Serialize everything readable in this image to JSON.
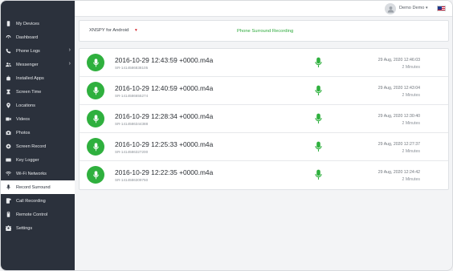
{
  "sidebar": {
    "items": [
      {
        "label": "My Devices",
        "icon": "phone-icon",
        "has_submenu": false
      },
      {
        "label": "Dashboard",
        "icon": "dashboard-icon",
        "has_submenu": false
      },
      {
        "label": "Phone Logs",
        "icon": "phone-logs-icon",
        "has_submenu": true
      },
      {
        "label": "Messenger",
        "icon": "users-icon",
        "has_submenu": true
      },
      {
        "label": "Installed Apps",
        "icon": "apps-icon",
        "has_submenu": false
      },
      {
        "label": "Screen Time",
        "icon": "hourglass-icon",
        "has_submenu": false
      },
      {
        "label": "Locations",
        "icon": "location-pin-icon",
        "has_submenu": false
      },
      {
        "label": "Videos",
        "icon": "video-icon",
        "has_submenu": false
      },
      {
        "label": "Photos",
        "icon": "camera-icon",
        "has_submenu": false
      },
      {
        "label": "Screen Record",
        "icon": "record-icon",
        "has_submenu": false
      },
      {
        "label": "Key Logger",
        "icon": "keyboard-icon",
        "has_submenu": false
      },
      {
        "label": "Wi-Fi Networks",
        "icon": "wifi-icon",
        "has_submenu": false
      },
      {
        "label": "Record Surround",
        "icon": "microphone-icon",
        "has_submenu": false,
        "active": true
      },
      {
        "label": "Call Recording",
        "icon": "call-recording-icon",
        "has_submenu": false
      },
      {
        "label": "Remote Control",
        "icon": "remote-control-icon",
        "has_submenu": false
      },
      {
        "label": "Settings",
        "icon": "gear-icon",
        "has_submenu": false
      }
    ]
  },
  "topbar": {
    "user_name": "Demo Demo",
    "user_caret": "▾",
    "flag_icon": "us-flag-icon"
  },
  "header": {
    "device_name": "XNSPY for Android",
    "device_caret": "▾",
    "title": "Phone Surround Recording"
  },
  "recordings": [
    {
      "file": "2016-10-29 12:43:59 +0000.m4a",
      "id": "SR-1414586838105",
      "date": "29 Aug, 2020 12:46:03",
      "duration": "2 Minutes"
    },
    {
      "file": "2016-10-29 12:40:59 +0000.m4a",
      "id": "SR-1414586655274",
      "date": "29 Aug, 2020 12:43:04",
      "duration": "2 Minutes"
    },
    {
      "file": "2016-10-29 12:28:34 +0000.m4a",
      "id": "SR-1414586344388",
      "date": "29 Aug, 2020 12:30:40",
      "duration": "2 Minutes"
    },
    {
      "file": "2016-10-29 12:25:33 +0000.m4a",
      "id": "SR-1414586327200",
      "date": "29 Aug, 2020 12:27:37",
      "duration": "2 Minutes"
    },
    {
      "file": "2016-10-29 12:22:35 +0000.m4a",
      "id": "SR-1414586309750",
      "date": "29 Aug, 2020 12:24:42",
      "duration": "2 Minutes"
    }
  ],
  "colors": {
    "sidebar_bg": "#2b313c",
    "accent_green": "#2fb03e",
    "title_green": "#2eaa3c",
    "caret_red": "#d0191f"
  }
}
